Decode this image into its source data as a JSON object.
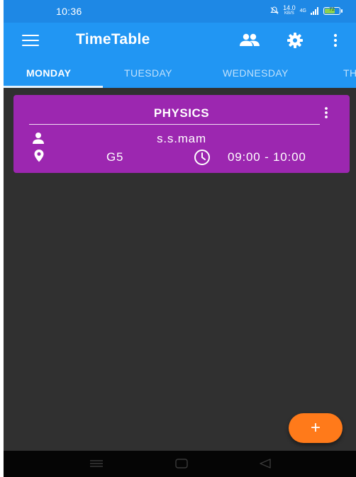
{
  "status_bar": {
    "time": "10:36",
    "net_speed_value": "14.0",
    "net_speed_unit": "KB/S",
    "network": "4G",
    "battery_level": "72"
  },
  "app_bar": {
    "title": "TimeTable",
    "icons": [
      "menu-icon",
      "people-icon",
      "gear-icon",
      "more-vert-icon"
    ]
  },
  "tabs": [
    {
      "label": "MONDAY",
      "active": true
    },
    {
      "label": "TUESDAY",
      "active": false
    },
    {
      "label": "WEDNESDAY",
      "active": false
    },
    {
      "label": "TH",
      "active": false
    }
  ],
  "card": {
    "subject": "PHYSICS",
    "teacher": "s.s.mam",
    "room": "G5",
    "time_range": "09:00 - 10:00",
    "color": "#9c27b0"
  },
  "fab": {
    "label": "+",
    "color": "#ff7a1a"
  },
  "colors": {
    "app_bar": "#2196f3",
    "status_bar": "#1e88e5",
    "background": "#303030"
  }
}
